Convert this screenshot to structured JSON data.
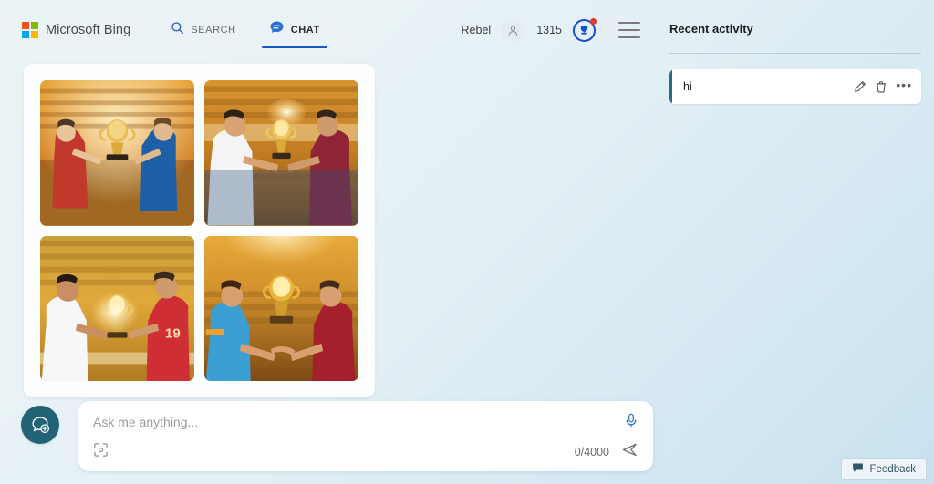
{
  "header": {
    "brand": {
      "name": "Microsoft Bing",
      "logo_icon": "microsoft-logo-icon",
      "logo_colors": [
        "#f25022",
        "#7fba00",
        "#00a4ef",
        "#ffb900"
      ]
    },
    "tabs": [
      {
        "label": "SEARCH",
        "icon": "search-icon",
        "active": false
      },
      {
        "label": "CHAT",
        "icon": "chat-bubble-icon",
        "active": true
      }
    ],
    "user": {
      "name": "Rebel",
      "avatar_icon": "person-icon",
      "points": "1315",
      "rewards_icon": "rewards-trophy-icon",
      "rewards_has_notification": true
    },
    "menu_icon": "hamburger-menu-icon",
    "accent_color": "#1a56c4"
  },
  "main": {
    "image_results": {
      "count": 4,
      "images": [
        {
          "alt": "Two footballers in red and blue kits exchanging a golden World Cup trophy in a sunlit stadium"
        },
        {
          "alt": "Footballers in white and claret-blue kits holding a gleaming trophy under stadium floodlights"
        },
        {
          "alt": "A player in white and a player in red number 19 shirt passing a golden trophy between them"
        },
        {
          "alt": "Two players shaking hands beneath a raised golden trophy in a glowing stadium"
        }
      ]
    }
  },
  "composer": {
    "new_chat_icon": "new-chat-bubble-plus-icon",
    "new_chat_color": "#236377",
    "placeholder": "Ask me anything...",
    "value": "",
    "mic_icon": "microphone-icon",
    "visual_search_icon": "visual-search-icon",
    "char_count": "0/4000",
    "send_icon": "send-arrow-icon"
  },
  "right_panel": {
    "title": "Recent activity",
    "items": [
      {
        "label": "hi",
        "accent_color": "#2b6b80",
        "edit_icon": "pencil-edit-icon",
        "delete_icon": "trash-delete-icon",
        "more_icon": "more-options-icon",
        "more_glyph": "•••"
      }
    ]
  },
  "feedback": {
    "label": "Feedback",
    "icon": "feedback-bubble-icon"
  }
}
